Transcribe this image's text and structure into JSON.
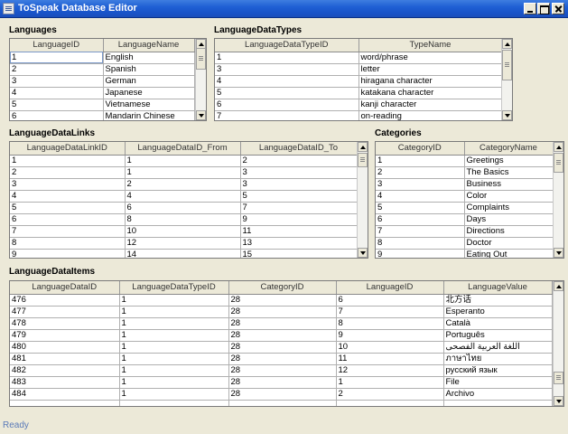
{
  "window": {
    "title": "ToSpeak Database Editor"
  },
  "languages": {
    "label": "Languages",
    "columns": [
      "LanguageID",
      "LanguageName"
    ],
    "rows": [
      [
        "1",
        "English"
      ],
      [
        "2",
        "Spanish"
      ],
      [
        "3",
        "German"
      ],
      [
        "4",
        "Japanese"
      ],
      [
        "5",
        "Vietnamese"
      ],
      [
        "6",
        "Mandarin Chinese"
      ]
    ]
  },
  "data_types": {
    "label": "LanguageDataTypes",
    "columns": [
      "LanguageDataTypeID",
      "TypeName"
    ],
    "rows": [
      [
        "1",
        "word/phrase"
      ],
      [
        "3",
        "letter"
      ],
      [
        "4",
        "hiragana character"
      ],
      [
        "5",
        "katakana character"
      ],
      [
        "6",
        "kanji character"
      ],
      [
        "7",
        "on-reading"
      ]
    ]
  },
  "data_links": {
    "label": "LanguageDataLinks",
    "columns": [
      "LanguageDataLinkID",
      "LanguageDataID_From",
      "LanguageDataID_To"
    ],
    "rows": [
      [
        "1",
        "1",
        "2"
      ],
      [
        "2",
        "1",
        "3"
      ],
      [
        "3",
        "2",
        "3"
      ],
      [
        "4",
        "4",
        "5"
      ],
      [
        "5",
        "6",
        "7"
      ],
      [
        "6",
        "8",
        "9"
      ],
      [
        "7",
        "10",
        "11"
      ],
      [
        "8",
        "12",
        "13"
      ],
      [
        "9",
        "14",
        "15"
      ]
    ]
  },
  "categories": {
    "label": "Categories",
    "columns": [
      "CategoryID",
      "CategoryName"
    ],
    "rows": [
      [
        "1",
        "Greetings"
      ],
      [
        "2",
        "The Basics"
      ],
      [
        "3",
        "Business"
      ],
      [
        "4",
        "Color"
      ],
      [
        "5",
        "Complaints"
      ],
      [
        "6",
        "Days"
      ],
      [
        "7",
        "Directions"
      ],
      [
        "8",
        "Doctor"
      ],
      [
        "9",
        "Eating Out"
      ]
    ]
  },
  "data_items": {
    "label": "LanguageDataItems",
    "columns": [
      "LanguageDataID",
      "LanguageDataTypeID",
      "CategoryID",
      "LanguageID",
      "LanguageValue"
    ],
    "rows": [
      [
        "476",
        "1",
        "28",
        "6",
        "北方话"
      ],
      [
        "477",
        "1",
        "28",
        "7",
        "Esperanto"
      ],
      [
        "478",
        "1",
        "28",
        "8",
        "Català"
      ],
      [
        "479",
        "1",
        "28",
        "9",
        "Português"
      ],
      [
        "480",
        "1",
        "28",
        "10",
        "اللغة العربية الفصحى"
      ],
      [
        "481",
        "1",
        "28",
        "11",
        "ภาษาไทย"
      ],
      [
        "482",
        "1",
        "28",
        "12",
        "русский язык"
      ],
      [
        "483",
        "1",
        "28",
        "1",
        "File"
      ],
      [
        "484",
        "1",
        "28",
        "2",
        "Archivo"
      ]
    ]
  },
  "status": {
    "text": "Ready"
  }
}
